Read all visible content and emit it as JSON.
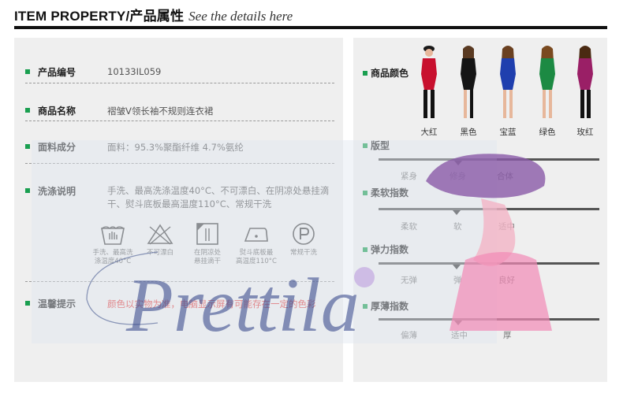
{
  "header": {
    "title": "ITEM PROPERTY/产品属性",
    "subtitle": "See the details here"
  },
  "properties": [
    {
      "label": "产品编号",
      "value": "10133IL059"
    },
    {
      "label": "商品名称",
      "value": "褶皱V领长袖不规则连衣裙"
    },
    {
      "label": "面料成分",
      "value": "面料：95.3%聚酯纤维        4.7%氨纶"
    },
    {
      "label": "洗涤说明",
      "value": "手洗、最高洗涤温度40°C、不可漂白、在阴凉处悬挂滴干、熨斗底板最高温度110°C、常规干洗"
    },
    {
      "label": "温馨提示",
      "value": "颜色以实物为准，电脑显示屏有可能存在一定的色彩"
    }
  ],
  "care_icons": [
    {
      "icon": "handwash-40-icon",
      "line1": "手洗、最高洗",
      "line2": "涤温度40°C"
    },
    {
      "icon": "no-bleach-icon",
      "line1": "不可漂白",
      "line2": ""
    },
    {
      "icon": "shade-dry-icon",
      "line1": "在阴凉处",
      "line2": "悬挂滴干"
    },
    {
      "icon": "iron-110-icon",
      "line1": "熨斗底板最",
      "line2": "高温度110°C"
    },
    {
      "icon": "dry-clean-p-icon",
      "line1": "常规干洗",
      "line2": ""
    }
  ],
  "colors": {
    "label": "商品颜色",
    "items": [
      {
        "name": "大红",
        "hex": "#c8102e"
      },
      {
        "name": "黑色",
        "hex": "#151515"
      },
      {
        "name": "宝蓝",
        "hex": "#1f3fae"
      },
      {
        "name": "绿色",
        "hex": "#1c8a43"
      },
      {
        "name": "玫红",
        "hex": "#9a1f66"
      }
    ]
  },
  "scales": [
    {
      "label": "版型",
      "options": [
        "紧身",
        "修身",
        "合体"
      ],
      "selected": 1
    },
    {
      "label": "柔软指数",
      "options": [
        "柔软",
        "软",
        "适中"
      ],
      "selected": 1
    },
    {
      "label": "弹力指数",
      "options": [
        "无弹",
        "弹",
        "良好"
      ],
      "selected": 1
    },
    {
      "label": "厚薄指数",
      "options": [
        "偏薄",
        "适中",
        "厚"
      ],
      "selected": 1
    }
  ],
  "watermark": {
    "text": "Prettila"
  },
  "accent": "#1a9f50"
}
